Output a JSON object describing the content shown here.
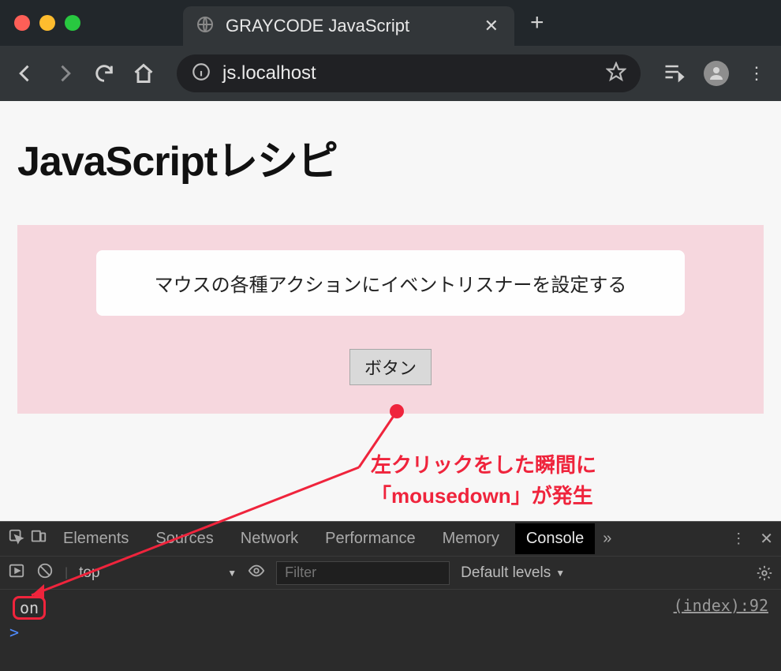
{
  "browser": {
    "tab_title": "GRAYCODE JavaScript",
    "url": "js.localhost"
  },
  "page": {
    "heading": "JavaScriptレシピ",
    "card_text": "マウスの各種アクションにイベントリスナーを設定する",
    "button_label": "ボタン"
  },
  "annotation": {
    "line1": "左クリックをした瞬間に",
    "line2": "「mousedown」が発生"
  },
  "devtools": {
    "tabs": {
      "elements": "Elements",
      "sources": "Sources",
      "network": "Network",
      "performance": "Performance",
      "memory": "Memory",
      "console": "Console"
    },
    "more": "»",
    "context_select": "top",
    "filter_placeholder": "Filter",
    "levels_label": "Default levels",
    "log_message": "on",
    "log_origin": "(index):92",
    "prompt": ">"
  }
}
